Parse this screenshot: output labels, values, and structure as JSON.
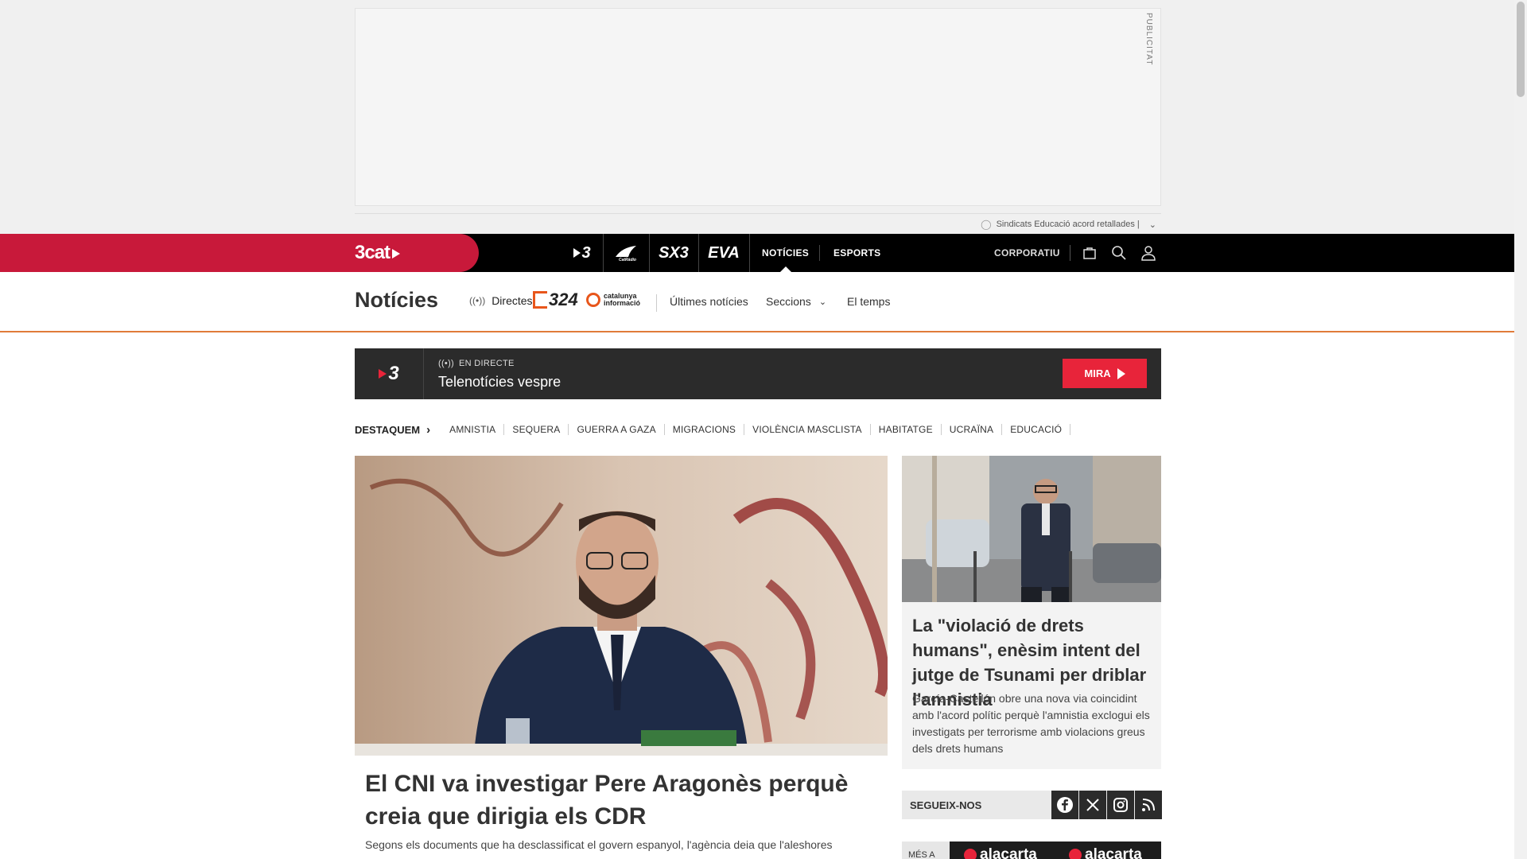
{
  "ad": {
    "label": "PUBLICITAT",
    "footer_text": "Sindicats Educació acord retallades |"
  },
  "topnav": {
    "brand": "3cat",
    "channels": [
      {
        "name": "3-icon",
        "label": "3"
      },
      {
        "name": "catradio-icon",
        "label": "CatRàdio"
      },
      {
        "name": "sx3-icon",
        "label": "SX3"
      },
      {
        "name": "eva-icon",
        "label": "EVA"
      }
    ],
    "links": [
      {
        "label": "NOTÍCIES",
        "active": true
      },
      {
        "label": "ESPORTS",
        "active": false
      }
    ],
    "corporate": "CORPORATIU",
    "icons": [
      "basket-icon",
      "search-icon",
      "user-icon"
    ]
  },
  "subnav": {
    "title": "Notícies",
    "directes": "Directes",
    "logo_324": "324",
    "logo_cat_info": "catalunya informació",
    "links": [
      "Últimes notícies",
      "Seccions",
      "El temps"
    ]
  },
  "live": {
    "channel": "3",
    "status": "EN DIRECTE",
    "program": "Telenotícies vespre",
    "button": "MIRA"
  },
  "highlights": {
    "label": "DESTAQUEM",
    "topics": [
      "AMNISTIA",
      "SEQUERA",
      "GUERRA A GAZA",
      "MIGRACIONS",
      "VIOLÈNCIA MASCLISTA",
      "HABITATGE",
      "UCRAÏNA",
      "EDUCACIÓ"
    ]
  },
  "main_article": {
    "title": "El CNI va investigar Pere Aragonès perquè creia que dirigia els CDR",
    "subtitle": "Segons els documents que ha desclassificat el govern espanyol, l'agència deia que l'aleshores"
  },
  "side_article": {
    "title": "La \"violació de drets humans\", enèsim intent del jutge de Tsunami per driblar l'amnistia",
    "subtitle": "García-Castellón obre una nova via coincidint amb l'acord polític perquè l'amnistia exclogui els investigats per terrorisme amb violacions greus dels drets humans"
  },
  "follow": {
    "label": "SEGUEIX-NOS",
    "networks": [
      "facebook-icon",
      "x-icon",
      "instagram-icon",
      "rss-icon"
    ]
  },
  "more": {
    "label": "MÉS A",
    "items": [
      "alacarta",
      "alacarta"
    ]
  },
  "colors": {
    "brand_red": "#c8193a",
    "live_red": "#e8243a",
    "accent_orange": "#e07b39",
    "nav_black": "#000000"
  }
}
